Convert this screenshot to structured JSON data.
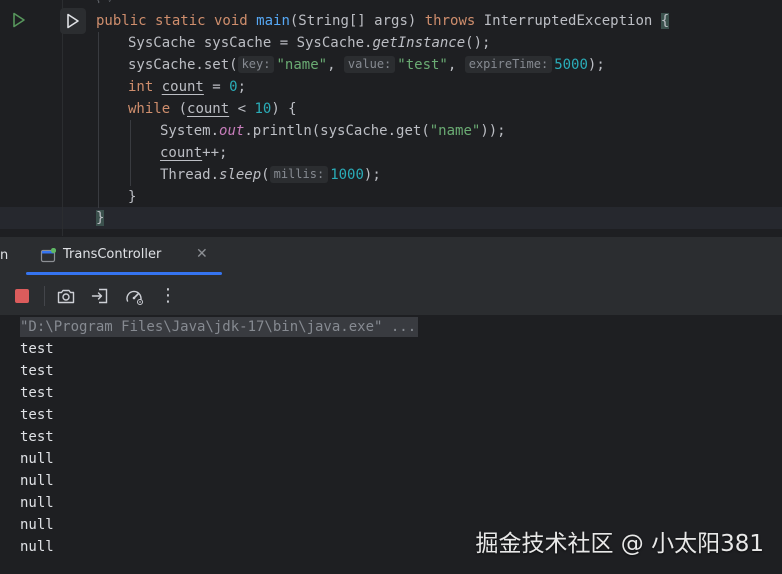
{
  "editor": {
    "hint_glyph": "⌇ ˅",
    "lines": {
      "l1": {
        "kw1": "public static void ",
        "fn": "main",
        "p1": "(String[] args) ",
        "kw2": "throws",
        "p2": " InterruptedException ",
        "brace": "{"
      },
      "l2": {
        "p1": "SysCache sysCache = SysCache.",
        "fn": "getInstance",
        "p2": "();"
      },
      "l3": {
        "p1": "sysCache.set(",
        "hint_key": "key:",
        "key": "\"name\"",
        "c1": ", ",
        "hint_value": "value:",
        "value": "\"test\"",
        "c2": ", ",
        "hint_expire": "expireTime:",
        "expire": "5000",
        "p2": ");"
      },
      "l4": {
        "kw": "int ",
        "var": "count",
        "p1": " = ",
        "num": "0",
        "p2": ";"
      },
      "l5": {
        "kw": "while ",
        "p1": "(",
        "var": "count",
        "p2": " < ",
        "num": "10",
        "p3": ") {"
      },
      "l6": {
        "p1": "System.",
        "field": "out",
        "p2": ".println(sysCache.get(",
        "str": "\"name\"",
        "p3": "));"
      },
      "l7": {
        "var": "count",
        "p1": "++;"
      },
      "l8": {
        "p1": "Thread.",
        "fn": "sleep",
        "p2": "(",
        "hint_millis": "millis:",
        "num": "1000",
        "p3": ");"
      },
      "l9": {
        "p1": "}"
      },
      "l10": {
        "p1": "}"
      }
    }
  },
  "tool_window": {
    "partial_tab": "n",
    "tab_label": "TransController",
    "close_glyph": "✕"
  },
  "toolbar": {
    "more_glyph": "⋮"
  },
  "console": {
    "command": "\"D:\\Program Files\\Java\\jdk-17\\bin\\java.exe\" ...",
    "output": [
      "test",
      "test",
      "test",
      "test",
      "test",
      "null",
      "null",
      "null",
      "null",
      "null"
    ]
  },
  "watermark": "掘金技术社区 @ 小太阳381",
  "colors": {
    "accent": "#3574f0",
    "keyword": "#cf8e6d",
    "function": "#56a8f5",
    "string": "#6aab73",
    "number": "#2aacb8",
    "stop": "#db5c5c",
    "run": "#57965c"
  }
}
